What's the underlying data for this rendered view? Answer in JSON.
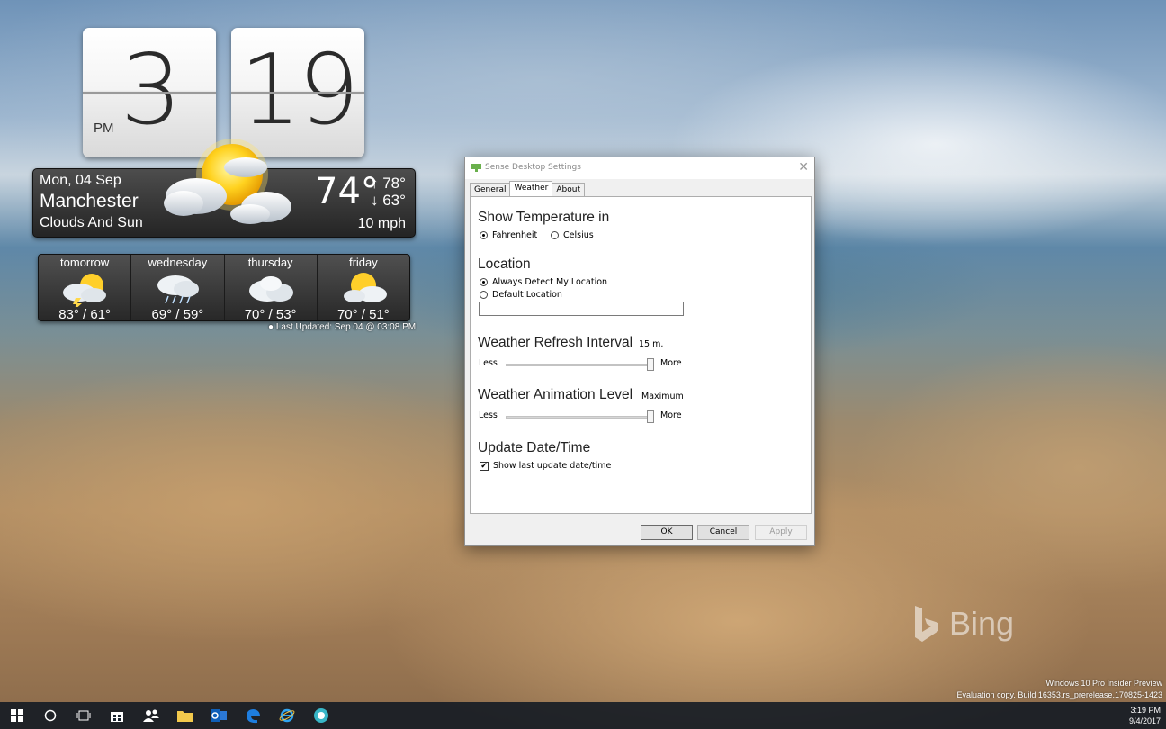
{
  "clock": {
    "hour": "3",
    "minute": "19",
    "ampm": "PM"
  },
  "weather": {
    "date": "Mon, 04 Sep",
    "city": "Manchester",
    "condition": "Clouds And Sun",
    "temp": "74°",
    "high": "↑ 78°",
    "low": "↓ 63°",
    "wind": "10 mph",
    "forecast": [
      {
        "day": "tomorrow",
        "temps": "83° / 61°",
        "icon": "thunder-sun-icon"
      },
      {
        "day": "wednesday",
        "temps": "69° / 59°",
        "icon": "rain-cloud-icon"
      },
      {
        "day": "thursday",
        "temps": "70° / 53°",
        "icon": "cloud-icon"
      },
      {
        "day": "friday",
        "temps": "70° / 51°",
        "icon": "partly-sunny-icon"
      }
    ],
    "last_updated": "● Last Updated: Sep 04 @ 03:08 PM"
  },
  "dialog": {
    "title": "Sense Desktop Settings",
    "close": "✕",
    "tabs": [
      "General",
      "Weather",
      "About"
    ],
    "active_tab": "Weather",
    "show_temp": {
      "heading": "Show Temperature in",
      "fahrenheit": "Fahrenheit",
      "celsius": "Celsius",
      "selected": "Fahrenheit"
    },
    "location": {
      "heading": "Location",
      "always_detect": "Always Detect My Location",
      "default_location": "Default Location",
      "value": "",
      "selected": "Always Detect My Location"
    },
    "refresh": {
      "heading": "Weather Refresh Interval",
      "value_label": "15 m.",
      "less": "Less",
      "more": "More",
      "level": 1.0
    },
    "animation": {
      "heading": "Weather Animation Level",
      "value_label": "Maximum",
      "less": "Less",
      "more": "More",
      "level": 1.0
    },
    "update": {
      "heading": "Update Date/Time",
      "checkbox_label": "Show last update date/time",
      "checked": true
    },
    "buttons": {
      "ok": "OK",
      "cancel": "Cancel",
      "apply": "Apply"
    }
  },
  "desktop": {
    "bing": "Bing",
    "watermark_line1": "Windows 10 Pro Insider Preview",
    "watermark_line2": "Evaluation copy. Build 16353.rs_prerelease.170825-1423"
  },
  "taskbar": {
    "time": "3:19 PM",
    "date": "9/4/2017",
    "icons": [
      "start-icon",
      "cortana-icon",
      "task-view-icon",
      "store-icon",
      "people-icon",
      "file-explorer-icon",
      "outlook-icon",
      "edge-icon",
      "ie-icon",
      "app-icon"
    ]
  }
}
